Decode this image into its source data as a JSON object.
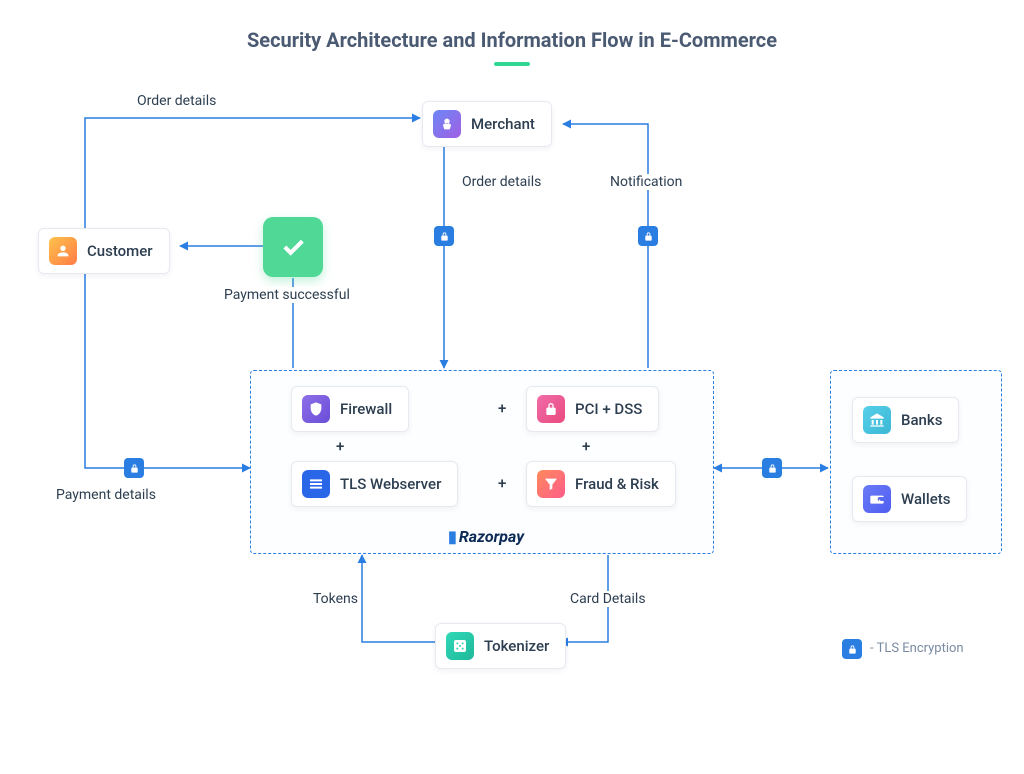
{
  "title": "Security Architecture and Information Flow in E-Commerce",
  "nodes": {
    "customer": "Customer",
    "merchant": "Merchant",
    "firewall": "Firewall",
    "pcidss": "PCI + DSS",
    "tls_webserver": "TLS Webserver",
    "fraud_risk": "Fraud & Risk",
    "tokenizer": "Tokenizer",
    "banks": "Banks",
    "wallets": "Wallets"
  },
  "edges": {
    "order_details_top": "Order details",
    "payment_successful": "Payment successful",
    "order_details_mid": "Order details",
    "notification": "Notification",
    "payment_details": "Payment details",
    "tokens": "Tokens",
    "card_details": "Card Details"
  },
  "brand": "Razorpay",
  "legend": "- TLS Encryption",
  "plus": "+"
}
